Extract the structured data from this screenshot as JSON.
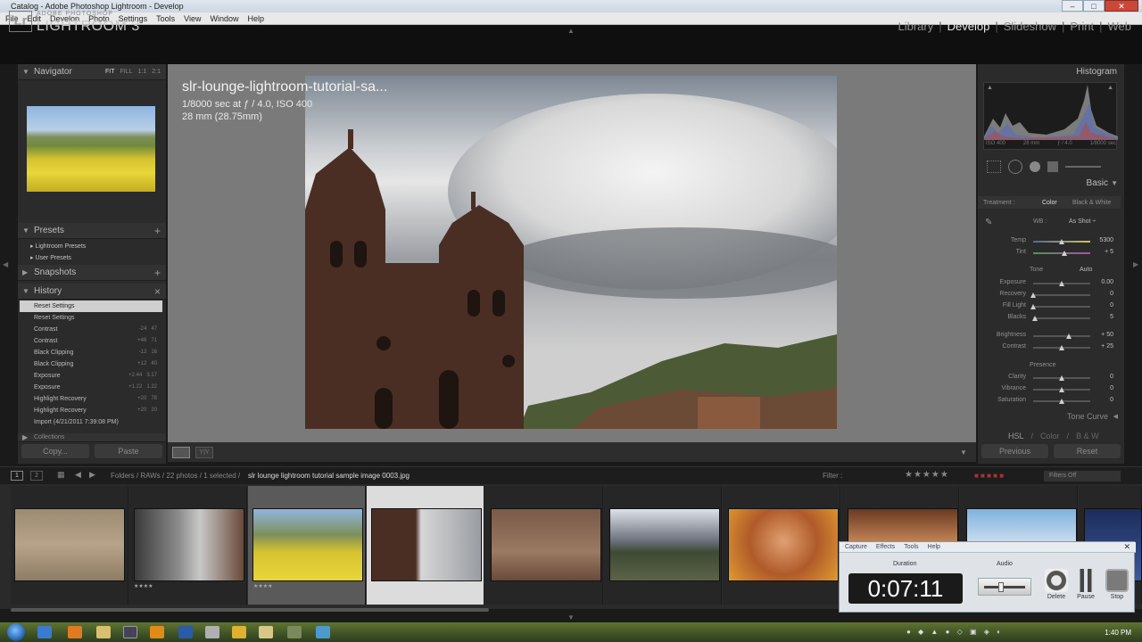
{
  "window": {
    "title": "Catalog - Adobe Photoshop Lightroom - Develop",
    "controls": [
      "–",
      "□",
      "✕"
    ]
  },
  "menu": [
    "File",
    "Edit",
    "Develop",
    "Photo",
    "Settings",
    "Tools",
    "View",
    "Window",
    "Help"
  ],
  "brand": {
    "small": "ADOBE PHOTOSHOP",
    "big": "LIGHTROOM 3",
    "logo": "Lr"
  },
  "modules": {
    "items": [
      "Library",
      "Develop",
      "Slideshow",
      "Print",
      "Web"
    ],
    "active": "Develop"
  },
  "left_panel": {
    "navigator": {
      "title": "Navigator",
      "zoom": [
        "FIT",
        "FILL",
        "1:1",
        "2:1"
      ]
    },
    "presets": {
      "title": "Presets",
      "items": [
        "Lightroom Presets",
        "User Presets"
      ]
    },
    "snapshots": {
      "title": "Snapshots"
    },
    "history": {
      "title": "History",
      "items": [
        {
          "label": "Reset Settings",
          "a": "",
          "b": ""
        },
        {
          "label": "Reset Settings",
          "a": "",
          "b": ""
        },
        {
          "label": "Contrast",
          "a": "-24",
          "b": "47"
        },
        {
          "label": "Contrast",
          "a": "+46",
          "b": "71"
        },
        {
          "label": "Black Clipping",
          "a": "-12",
          "b": "16"
        },
        {
          "label": "Black Clipping",
          "a": "+12",
          "b": "40"
        },
        {
          "label": "Exposure",
          "a": "+2.44",
          "b": "3.17"
        },
        {
          "label": "Exposure",
          "a": "+1.22",
          "b": "1.22"
        },
        {
          "label": "Highlight Recovery",
          "a": "+20",
          "b": "78"
        },
        {
          "label": "Highlight Recovery",
          "a": "+20",
          "b": "20"
        },
        {
          "label": "Import (4/21/2011 7:39:08 PM)",
          "a": "",
          "b": ""
        }
      ],
      "collections_title": "Collections"
    },
    "buttons": {
      "copy": "Copy...",
      "paste": "Paste"
    }
  },
  "photo_info": {
    "filename": "slr-lounge-lightroom-tutorial-sa...",
    "exposure": "1/8000 sec at ƒ / 4.0, ISO 400",
    "focal": "28 mm (28.75mm)"
  },
  "right_panel": {
    "histogram": {
      "title": "Histogram",
      "info": [
        "ISO 400",
        "28 mm",
        "ƒ / 4.0",
        "1/8000 sec"
      ]
    },
    "basic": {
      "title": "Basic",
      "treatment_label": "Treatment :",
      "treatment_options": [
        "Color",
        "Black & White"
      ],
      "wb_label": "WB :",
      "wb_value": "As Shot ÷",
      "temp": {
        "label": "Temp",
        "value": "5300",
        "pos": 0.5
      },
      "tint": {
        "label": "Tint",
        "value": "+ 5",
        "pos": 0.55
      },
      "tone_label": "Tone",
      "auto_label": "Auto",
      "tone": [
        {
          "label": "Exposure",
          "value": "0.00",
          "pos": 0.5
        },
        {
          "label": "Recovery",
          "value": "0",
          "pos": 0.0
        },
        {
          "label": "Fill Light",
          "value": "0",
          "pos": 0.0
        },
        {
          "label": "Blacks",
          "value": "5",
          "pos": 0.03
        },
        {
          "label": "Brightness",
          "value": "+ 50",
          "pos": 0.62
        },
        {
          "label": "Contrast",
          "value": "+ 25",
          "pos": 0.5
        }
      ],
      "presence_label": "Presence",
      "presence": [
        {
          "label": "Clarity",
          "value": "0",
          "pos": 0.5
        },
        {
          "label": "Vibrance",
          "value": "0",
          "pos": 0.5
        },
        {
          "label": "Saturation",
          "value": "0",
          "pos": 0.5
        }
      ]
    },
    "tone_curve": "Tone Curve",
    "hsl": {
      "items": [
        "HSL",
        "Color",
        "B & W"
      ]
    },
    "buttons": {
      "previous": "Previous",
      "reset": "Reset"
    }
  },
  "filmstrip_bar": {
    "pages": [
      "1",
      "2"
    ],
    "path": "Folders / RAWs / 22 photos / 1 selected /",
    "selected_file": "slr lounge lightroom tutorial sample image 0003.jpg",
    "filter_label": "Filter :",
    "filters_off": "Filters Off"
  },
  "recorder": {
    "menu": [
      "Capture",
      "Effects",
      "Tools",
      "Help"
    ],
    "duration_label": "Duration",
    "time": "0:07:11",
    "audio_label": "Audio",
    "buttons": [
      "Delete",
      "Pause",
      "Stop"
    ]
  },
  "taskbar": {
    "clock": "1:40 PM"
  },
  "colors": {
    "accent": "#e8e8e8",
    "panel": "#2b2b2b",
    "workspace": "#7a7a7a"
  }
}
